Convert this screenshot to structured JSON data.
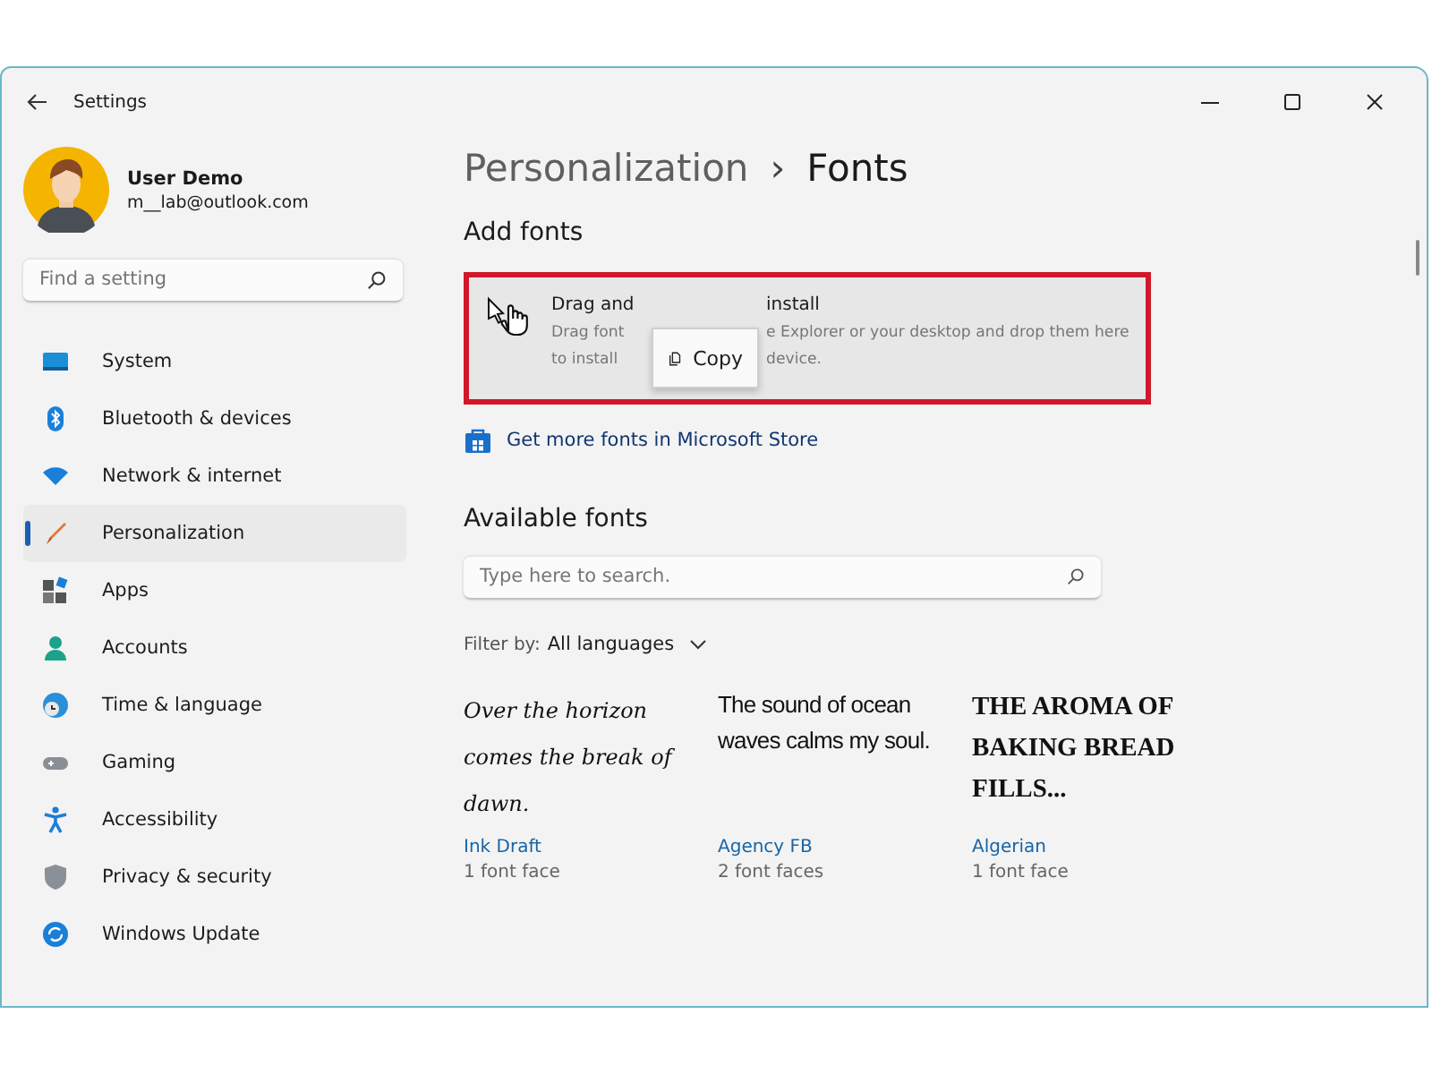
{
  "window": {
    "title": "Settings"
  },
  "user": {
    "name": "User Demo",
    "email": "m__lab@outlook.com"
  },
  "sidebar": {
    "search": {
      "placeholder": "Find a setting"
    },
    "items": [
      {
        "label": "System",
        "selected": false
      },
      {
        "label": "Bluetooth & devices",
        "selected": false
      },
      {
        "label": "Network & internet",
        "selected": false
      },
      {
        "label": "Personalization",
        "selected": true
      },
      {
        "label": "Apps",
        "selected": false
      },
      {
        "label": "Accounts",
        "selected": false
      },
      {
        "label": "Time & language",
        "selected": false
      },
      {
        "label": "Gaming",
        "selected": false
      },
      {
        "label": "Accessibility",
        "selected": false
      },
      {
        "label": "Privacy & security",
        "selected": false
      },
      {
        "label": "Windows Update",
        "selected": false
      }
    ]
  },
  "breadcrumb": {
    "parent": "Personalization",
    "separator": "›",
    "current": "Fonts"
  },
  "add_fonts": {
    "heading": "Add fonts",
    "title_parts": [
      "Drag and",
      "install"
    ],
    "description_lines": [
      [
        "Drag font",
        "e Explorer or your desktop and drop them here"
      ],
      [
        "to install",
        "device."
      ]
    ],
    "drag_tooltip": "Copy",
    "store_link": "Get more fonts in Microsoft Store"
  },
  "available_fonts": {
    "heading": "Available fonts",
    "search": {
      "placeholder": "Type here to search."
    },
    "filter_label": "Filter by:",
    "filter_value": "All languages",
    "fonts": [
      {
        "kind": "script",
        "sample": "Over the horizon comes the break of dawn.",
        "name": "Ink Draft",
        "faces": "1 font face"
      },
      {
        "kind": "condensed",
        "sample": "The sound of ocean waves calms my soul.",
        "name": "Agency FB",
        "faces": "2 font faces"
      },
      {
        "kind": "display",
        "sample": "THE AROMA OF BAKING BREAD FILLS...",
        "name": "Algerian",
        "faces": "1 font face"
      }
    ]
  }
}
